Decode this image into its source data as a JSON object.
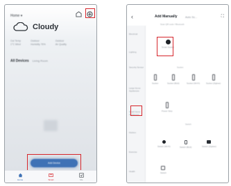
{
  "left_screen": {
    "home_label": "Home ▾",
    "weather": {
      "label": "Cloudy",
      "icon": "cloud-icon"
    },
    "metrics": [
      {
        "line1": "Out Temp",
        "line2": "1°C Wind"
      },
      {
        "line1": "Outdoor",
        "line2": "Humidity 76%"
      },
      {
        "line1": "Outdoor",
        "line2": "Air Quality"
      }
    ],
    "tabs": {
      "active": "All Devices",
      "others": "Living Room"
    },
    "add_button_label": "Add Device",
    "nav": [
      {
        "label": "Home",
        "icon": "home-icon"
      },
      {
        "label": "Smart",
        "icon": "smart-icon"
      },
      {
        "label": "Me",
        "icon": "me-icon"
      }
    ]
  },
  "right_screen": {
    "back_icon": "back-arrow-icon",
    "title": "Add Manually",
    "auto_tab": "Auto Sc...",
    "expand_icon": "expand-icon",
    "subtitle": "Scan QR code / Bluetooth",
    "sidebar": [
      "Electrical",
      "Lighting",
      "Security Sensor",
      "Large Home Appliances",
      "Small Home Appliances",
      "Kitchen",
      "Exercise",
      "Health"
    ],
    "sections": [
      {
        "title": "Popular"
      },
      {
        "title": "Socket"
      },
      {
        "title": "Switch"
      }
    ],
    "highlighted_device": "Smart Socket",
    "devices_row1": [
      "Socket",
      "Socket (BLE)",
      "Socket (Wi-Fi)",
      "Socket (Zigbee)"
    ],
    "devices_row2": [
      "Power Strip"
    ],
    "devices_row3": [
      "Switch (Wi-Fi)",
      "Switch (BLE)",
      "Switch (Zigbee)"
    ],
    "devices_row4": [
      "Switch"
    ]
  },
  "colors": {
    "highlight": "#d6252b",
    "accent": "#3f72b5"
  }
}
